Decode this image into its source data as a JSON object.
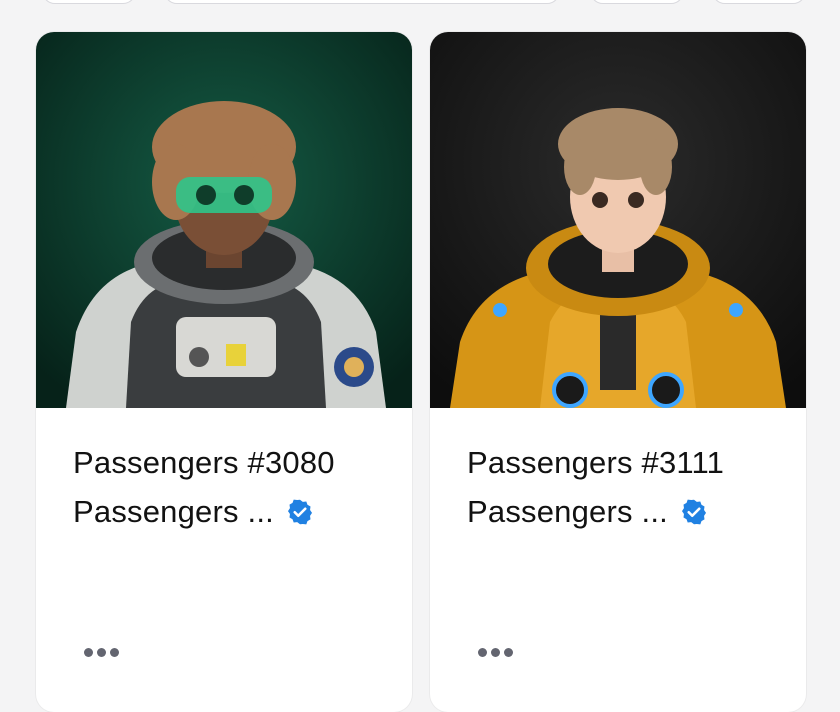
{
  "cards": [
    {
      "title": "Passengers #3080",
      "collection": "Passengers ...",
      "verified": true,
      "background_color": "#0c3a2e",
      "accent_color": "#34d399"
    },
    {
      "title": "Passengers #3111",
      "collection": "Passengers ...",
      "verified": true,
      "background_color": "#1a1a1a",
      "accent_color": "#e3a21a"
    }
  ],
  "icons": {
    "verified": "verified-badge-icon",
    "more": "more-options-icon"
  },
  "colors": {
    "verified_blue": "#2081e2",
    "text": "#121212"
  }
}
